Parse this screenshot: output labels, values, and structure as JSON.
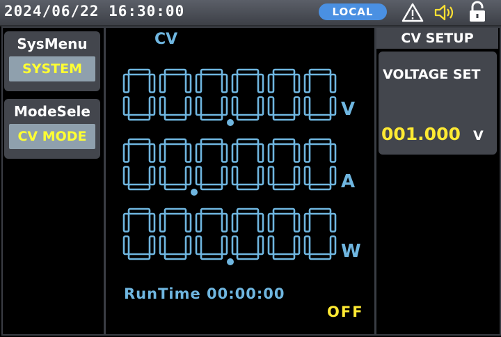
{
  "status_bar": {
    "datetime": "2024/06/22 16:30:00",
    "mode_badge": "LOCAL",
    "icons": [
      "warning-icon",
      "speaker-icon",
      "lock-icon"
    ]
  },
  "left_menu": {
    "items": [
      {
        "title": "SysMenu",
        "value": "SYSTEM"
      },
      {
        "title": "ModeSele",
        "value": "CV MODE"
      }
    ]
  },
  "display": {
    "mode": "CV",
    "readings": [
      {
        "digits": "000000",
        "decimal_after": 3,
        "unit": "V"
      },
      {
        "digits": "000000",
        "decimal_after": 2,
        "unit": "A"
      },
      {
        "digits": "000000",
        "decimal_after": 3,
        "unit": "W"
      }
    ],
    "runtime_label": "RunTime",
    "runtime_value": "00:00:00",
    "output_state": "OFF"
  },
  "setup_panel": {
    "title": "CV SETUP",
    "param_label": "VOLTAGE SET",
    "param_value": "001.000",
    "param_unit": "V"
  },
  "colors": {
    "segment": "#6fb6e0",
    "highlight": "#ffea33",
    "badge": "#4a90e2"
  }
}
